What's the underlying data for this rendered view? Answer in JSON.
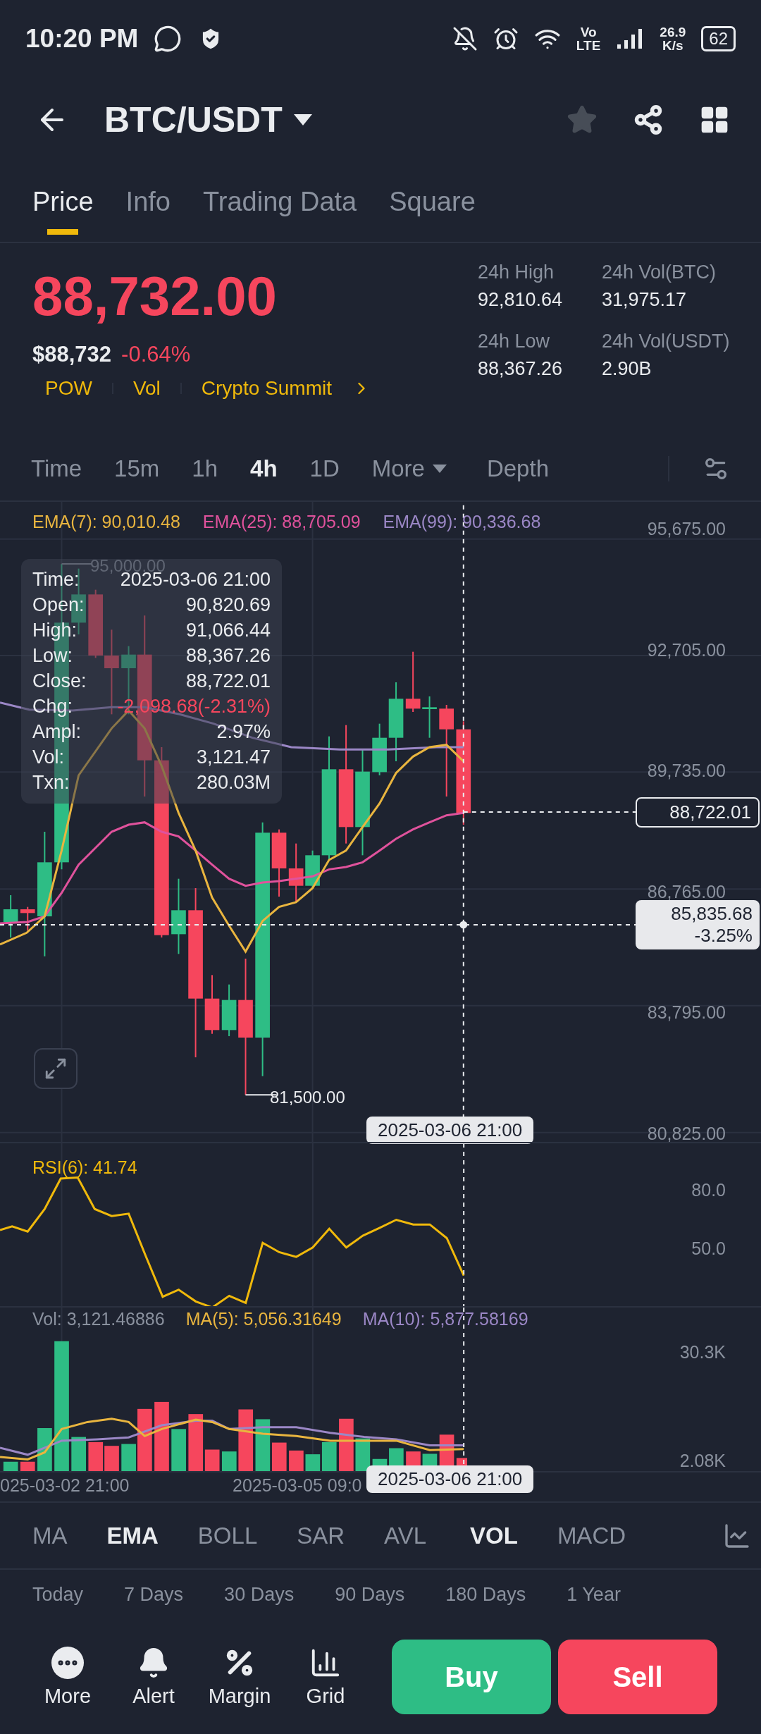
{
  "status_bar": {
    "time": "10:20 PM",
    "network_top": "Vo",
    "network_bottom": "LTE",
    "speed_value": "26.9",
    "speed_unit": "K/s",
    "battery": "62"
  },
  "header": {
    "pair": "BTC/USDT",
    "favorite": false
  },
  "tabs": [
    {
      "label": "Price",
      "selected": true
    },
    {
      "label": "Info",
      "selected": false
    },
    {
      "label": "Trading Data",
      "selected": false
    },
    {
      "label": "Square",
      "selected": false
    }
  ],
  "price": {
    "last": "88,732.00",
    "fiat": "$88,732",
    "change": "-0.64%",
    "tags": [
      "POW",
      "Vol",
      "Crypto Summit"
    ]
  },
  "stats": [
    {
      "label": "24h High",
      "value": "92,810.64"
    },
    {
      "label": "24h Vol(BTC)",
      "value": "31,975.17"
    },
    {
      "label": "24h Low",
      "value": "88,367.26"
    },
    {
      "label": "24h Vol(USDT)",
      "value": "2.90B"
    }
  ],
  "intervals": [
    {
      "label": "Time",
      "kind": "interval",
      "selected": false
    },
    {
      "label": "15m",
      "kind": "interval",
      "selected": false
    },
    {
      "label": "1h",
      "kind": "interval",
      "selected": false
    },
    {
      "label": "4h",
      "kind": "interval",
      "selected": true
    },
    {
      "label": "1D",
      "kind": "interval",
      "selected": false
    },
    {
      "label": "More",
      "kind": "dropdown",
      "selected": false
    },
    {
      "label": "Depth",
      "kind": "view",
      "selected": false
    }
  ],
  "chart": {
    "legend": [
      {
        "label": "EMA(7): 90,010.48",
        "color": "#e9b53f"
      },
      {
        "label": "EMA(25): 88,705.09",
        "color": "#e0529c"
      },
      {
        "label": "EMA(99): 90,336.68",
        "color": "#9b87c6"
      }
    ],
    "y_axis_labels": [
      "95,675.00",
      "92,705.00",
      "89,735.00",
      "86,765.00",
      "83,795.00",
      "80,825.00"
    ],
    "high_marker": "95,000.00",
    "low_marker": "81,500.00",
    "last_price_tag": "88,722.01",
    "crosshair_price": "85,835.68",
    "crosshair_change": "-3.25%",
    "crosshair_time": "2025-03-06 21:00",
    "tooltip": [
      {
        "label": "Time:",
        "value": "2025-03-06 21:00",
        "negative": false
      },
      {
        "label": "Open:",
        "value": "90,820.69",
        "negative": false
      },
      {
        "label": "High:",
        "value": "91,066.44",
        "negative": false
      },
      {
        "label": "Low:",
        "value": "88,367.26",
        "negative": false
      },
      {
        "label": "Close:",
        "value": "88,722.01",
        "negative": false
      },
      {
        "label": "Chg:",
        "value": "-2,098.68(-2.31%)",
        "negative": true
      },
      {
        "label": "Ampl:",
        "value": "2.97%",
        "negative": false
      },
      {
        "label": "Vol:",
        "value": "3,121.47",
        "negative": false
      },
      {
        "label": "Txn:",
        "value": "280.03M",
        "negative": false
      }
    ]
  },
  "rsi": {
    "legend": "RSI(6): 41.74",
    "y_axis_labels": [
      "80.0",
      "50.0"
    ]
  },
  "volume": {
    "legend": [
      {
        "label": "Vol: 3,121.46886",
        "color": "#8a919e"
      },
      {
        "label": "MA(5): 5,056.31649",
        "color": "#e9b53f"
      },
      {
        "label": "MA(10): 5,877.58169",
        "color": "#9b87c6"
      }
    ],
    "y_axis_labels": [
      "30.3K",
      "2.08K"
    ],
    "x_axis_labels": [
      "025-03-02 21:00",
      "2025-03-05 09:0"
    ],
    "crosshair_time": "2025-03-06 21:00"
  },
  "indicators": {
    "main": [
      {
        "label": "MA",
        "selected": false
      },
      {
        "label": "EMA",
        "selected": true
      },
      {
        "label": "BOLL",
        "selected": false
      },
      {
        "label": "SAR",
        "selected": false
      },
      {
        "label": "AVL",
        "selected": false
      }
    ],
    "sub": [
      {
        "label": "VOL",
        "selected": true
      },
      {
        "label": "MACD",
        "selected": false
      }
    ]
  },
  "periods": [
    "Today",
    "7 Days",
    "30 Days",
    "90 Days",
    "180 Days",
    "1 Year"
  ],
  "bottom_bar": {
    "actions": [
      {
        "label": "More",
        "kind": "more"
      },
      {
        "label": "Alert",
        "kind": "alert"
      },
      {
        "label": "Margin",
        "kind": "margin"
      },
      {
        "label": "Grid",
        "kind": "grid"
      }
    ],
    "buy": "Buy",
    "sell": "Sell"
  }
}
